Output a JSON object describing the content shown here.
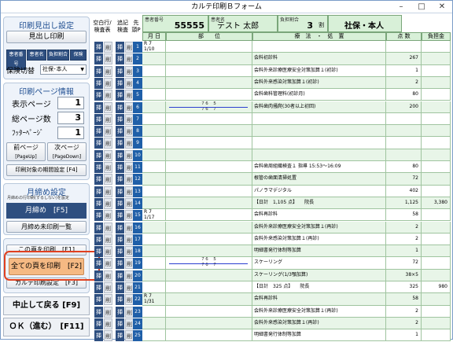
{
  "window": {
    "title": "カルテ印刷Ｂフォーム"
  },
  "left": {
    "print_header": {
      "title": "印刷見出し設定",
      "button": "見出し印刷",
      "opts": [
        "患者番号",
        "患者名",
        "負担割合",
        "保険"
      ],
      "insurance_label": "保険切替",
      "insurance_value": "社保･本人"
    },
    "page_info": {
      "title": "印刷ページ情報",
      "display_page_label": "表示ページ",
      "display_page": "1",
      "total_pages_label": "総ページ数",
      "total_pages": "3",
      "footer_label": "ﾌｯﾀｰﾍﾟｰｼﾞ",
      "footer": "1",
      "prev": "前ページ",
      "prev_sub": "[PageUp]",
      "next": "次ページ",
      "next_sub": "[PageDown]",
      "period": "印刷対象の期間設定 [F4]"
    },
    "monthly": {
      "title": "月締め設定",
      "note": "月締めの行印刷(するしない)を設定",
      "close": "月締め　[F5]",
      "unprinted": "月締め未印刷一覧"
    },
    "print": {
      "this_page": "この頁を印刷　[F1]",
      "all_pages": "全ての頁を印刷　[F2]",
      "karte_setting": "カルテ印刷設定　[F3]"
    },
    "cancel": "中止して戻る [F9]",
    "ok": "ＯＫ（進む）　[F11]"
  },
  "mid": {
    "col1": "空白行/検査表",
    "col2": "追記検査",
    "col3": "先頭P",
    "btn1": "挿",
    "btn2": "削"
  },
  "header": {
    "patient_no_cap": "患者番号",
    "patient_no": "55555",
    "name_cap": "患者名",
    "name": "テスト 太郎",
    "burden_cap": "負担割合",
    "burden": "3",
    "burden_unit": "割",
    "insurance": "社保・本人"
  },
  "grid": {
    "headers": [
      "月 日",
      "部　　位",
      "療　法　・　処　置",
      "点 数",
      "負担金"
    ],
    "rows": [
      {
        "n": "1",
        "date": "R 7\n1/10",
        "body": "",
        "proc": "",
        "pts": "",
        "burden": ""
      },
      {
        "n": "2",
        "date": "",
        "body": "",
        "proc": "会料初診料",
        "pts": "267",
        "burden": ""
      },
      {
        "n": "3",
        "date": "",
        "body": "",
        "proc": "会料外来診療医療安全対策加算１(初診)",
        "pts": "1",
        "burden": ""
      },
      {
        "n": "4",
        "date": "",
        "body": "",
        "proc": "会料外来感染対策加算１(初診)",
        "pts": "2",
        "burden": ""
      },
      {
        "n": "5",
        "date": "",
        "body": "",
        "proc": "会料歯科管理料(初診月)",
        "pts": "80",
        "burden": ""
      },
      {
        "n": "6",
        "date": "",
        "body": "７６　５\n７６　７",
        "proc": "会料歯肉掻爬(30者以上初回)",
        "pts": "200",
        "burden": ""
      },
      {
        "n": "7",
        "date": "",
        "body": "",
        "proc": "",
        "pts": "",
        "burden": ""
      },
      {
        "n": "8",
        "date": "",
        "body": "",
        "proc": "",
        "pts": "",
        "burden": ""
      },
      {
        "n": "9",
        "date": "",
        "body": "",
        "proc": "",
        "pts": "",
        "burden": ""
      },
      {
        "n": "10",
        "date": "",
        "body": "",
        "proc": "",
        "pts": "",
        "burden": ""
      },
      {
        "n": "11",
        "date": "",
        "body": "",
        "proc": "会料歯周組織検査１ 指導 15:53～16:09",
        "pts": "80",
        "burden": ""
      },
      {
        "n": "12",
        "date": "",
        "body": "",
        "proc": "根管の歯面清掃処置",
        "pts": "72",
        "burden": ""
      },
      {
        "n": "13",
        "date": "",
        "body": "",
        "proc": "パノラマデジタル",
        "pts": "402",
        "burden": ""
      },
      {
        "n": "14",
        "date": "",
        "body": "",
        "proc": "【日計　1,105 点】　　院長",
        "pts": "1,125",
        "burden": "3,380"
      },
      {
        "n": "15",
        "date": "R 7\n1/17",
        "body": "",
        "proc": "会料再診料",
        "pts": "58",
        "burden": ""
      },
      {
        "n": "16",
        "date": "",
        "body": "",
        "proc": "会料外来診療医療安全対策加算１(再診)",
        "pts": "2",
        "burden": ""
      },
      {
        "n": "17",
        "date": "",
        "body": "",
        "proc": "会料外来感染対策加算１(再診)",
        "pts": "2",
        "burden": ""
      },
      {
        "n": "18",
        "date": "",
        "body": "",
        "proc": "明細書発行体制等加算",
        "pts": "1",
        "burden": ""
      },
      {
        "n": "19",
        "date": "",
        "body": "７６　５\n７６　７",
        "proc": "スケーリング",
        "pts": "72",
        "burden": ""
      },
      {
        "n": "20",
        "date": "",
        "body": "",
        "proc": "スケーリング(1/3顎加算)",
        "pts": "38×5",
        "burden": ""
      },
      {
        "n": "21",
        "date": "",
        "body": "",
        "proc": "【日計　325 点】　　院長",
        "pts": "325",
        "burden": "980"
      },
      {
        "n": "22",
        "date": "R 7\n1/31",
        "body": "",
        "proc": "会料再診料",
        "pts": "58",
        "burden": ""
      },
      {
        "n": "23",
        "date": "",
        "body": "",
        "proc": "会料外来診療医療安全対策加算１(再診)",
        "pts": "2",
        "burden": ""
      },
      {
        "n": "24",
        "date": "",
        "body": "",
        "proc": "会料外来感染対策加算１(再診)",
        "pts": "2",
        "burden": ""
      },
      {
        "n": "25",
        "date": "",
        "body": "",
        "proc": "明細書発行体制等加算",
        "pts": "1",
        "burden": ""
      }
    ]
  }
}
